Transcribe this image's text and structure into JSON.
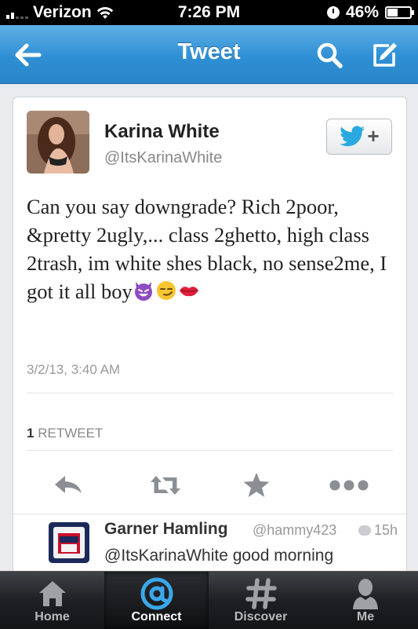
{
  "status_bar": {
    "carrier": "Verizon",
    "time": "7:26 PM",
    "battery": "46%",
    "battery_level": 0.46,
    "icons": [
      "signal-icon",
      "wifi-icon",
      "clock-icon",
      "battery-icon"
    ]
  },
  "nav": {
    "title": "Tweet",
    "icons": [
      "back-arrow-icon",
      "search-icon",
      "compose-icon"
    ]
  },
  "tweet": {
    "author_name": "Karina White",
    "author_handle": "@ItsKarinaWhite",
    "text": "Can you say downgrade? Rich 2poor, &pretty 2ugly,... class 2ghetto, high class 2trash, im white shes black, no sense2me, I got it all boy",
    "emojis": [
      "smiling-devil-emoji",
      "smirk-emoji",
      "kiss-lips-emoji"
    ],
    "timestamp": "3/2/13, 3:40 AM",
    "retweet_count": "1",
    "retweet_label": "RETWEET",
    "actions": [
      "reply-icon",
      "retweet-icon",
      "favorite-star-icon",
      "more-icon"
    ]
  },
  "reply": {
    "name": "Garner Hamling",
    "handle": "@hammy423",
    "time": "15h",
    "text": "@ItsKarinaWhite good morning"
  },
  "tabs": [
    {
      "label": "Home",
      "icon": "home-icon",
      "active": false
    },
    {
      "label": "Connect",
      "icon": "at-sign-icon",
      "active": true
    },
    {
      "label": "Discover",
      "icon": "hashtag-icon",
      "active": false
    },
    {
      "label": "Me",
      "icon": "person-icon",
      "active": false
    }
  ],
  "colors": {
    "nav_blue": "#2f8fd4",
    "twitter_blue": "#2aa9e0",
    "tab_bar": "#1e2023"
  }
}
